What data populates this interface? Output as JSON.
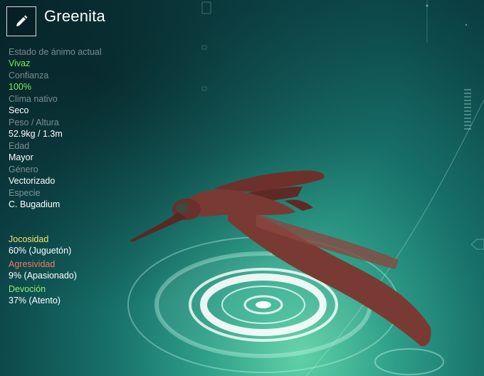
{
  "creature": {
    "name": "Greenita",
    "edit_icon": "pencil-icon"
  },
  "stats": [
    {
      "label": "Estado de ánimo actual",
      "value": "Vivaz",
      "highlight": "#7cf05a"
    },
    {
      "label": "Confianza",
      "value": "100%",
      "highlight": "#7cf05a"
    },
    {
      "label": "Clima nativo",
      "value": "Seco"
    },
    {
      "label": "Peso / Altura",
      "value": "52.9kg / 1.3m"
    },
    {
      "label": "Edad",
      "value": "Mayor"
    },
    {
      "label": "Género",
      "value": "Vectorizado"
    },
    {
      "label": "Especie",
      "value": "C. Bugadium"
    }
  ],
  "traits": [
    {
      "label": "Jocosidad",
      "value": "60% (Juguetón)",
      "color": "#f2e36a"
    },
    {
      "label": "Agresividad",
      "value": "9% (Apasionado)",
      "color": "#f07a5a"
    },
    {
      "label": "Devoción",
      "value": "37% (Atento)",
      "color": "#8ff06a"
    }
  ],
  "colors": {
    "creature_body": "#7a3a34",
    "ring": "#ffffff"
  }
}
